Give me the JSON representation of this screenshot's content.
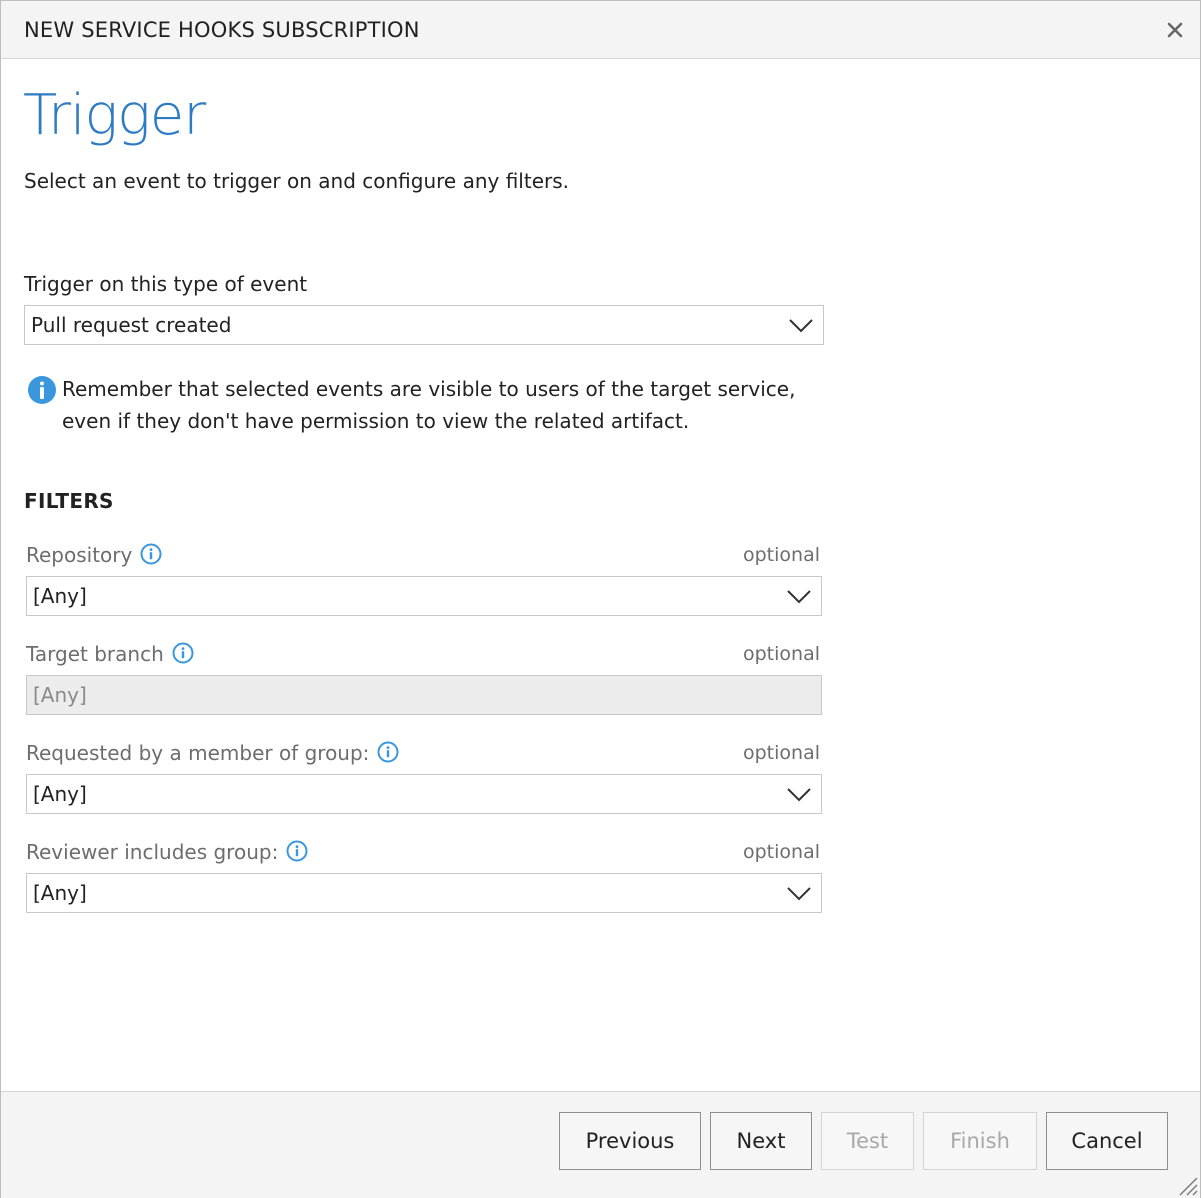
{
  "dialog": {
    "title": "NEW SERVICE HOOKS SUBSCRIPTION",
    "close_icon": "close-icon"
  },
  "page": {
    "heading": "Trigger",
    "subheading": "Select an event to trigger on and configure any filters."
  },
  "event": {
    "label": "Trigger on this type of event",
    "value": "Pull request created"
  },
  "note": {
    "icon": "info-icon",
    "text": "Remember that selected events are visible to users of the target service, even if they don't have permission to view the related artifact."
  },
  "filters": {
    "heading": "FILTERS",
    "optional_label": "optional",
    "repository": {
      "label": "Repository",
      "value": "[Any]",
      "disabled": false
    },
    "target_branch": {
      "label": "Target branch",
      "value": "[Any]",
      "disabled": true
    },
    "requested_by": {
      "label": "Requested by a member of group:",
      "value": "[Any]",
      "disabled": false
    },
    "reviewer": {
      "label": "Reviewer includes group:",
      "value": "[Any]",
      "disabled": false
    }
  },
  "footer": {
    "previous": "Previous",
    "next": "Next",
    "test": "Test",
    "finish": "Finish",
    "cancel": "Cancel"
  },
  "colors": {
    "accent": "#2e7bc5",
    "info_icon": "#3a96dd"
  }
}
